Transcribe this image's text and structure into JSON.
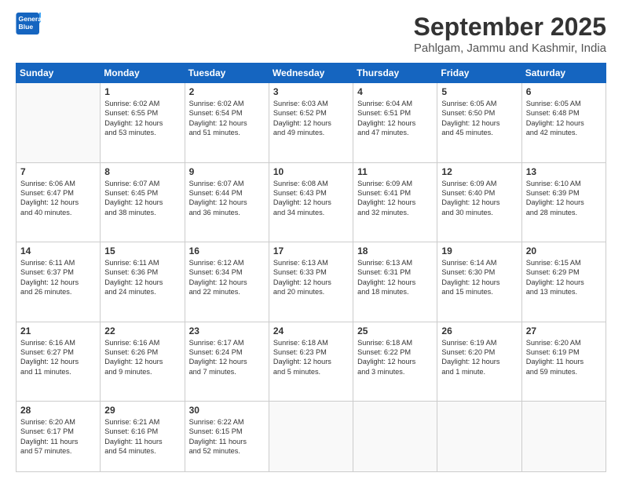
{
  "logo": {
    "line1": "General",
    "line2": "Blue"
  },
  "header": {
    "month": "September 2025",
    "location": "Pahlgam, Jammu and Kashmir, India"
  },
  "days": [
    "Sunday",
    "Monday",
    "Tuesday",
    "Wednesday",
    "Thursday",
    "Friday",
    "Saturday"
  ],
  "weeks": [
    [
      {
        "day": "",
        "info": ""
      },
      {
        "day": "1",
        "info": "Sunrise: 6:02 AM\nSunset: 6:55 PM\nDaylight: 12 hours\nand 53 minutes."
      },
      {
        "day": "2",
        "info": "Sunrise: 6:02 AM\nSunset: 6:54 PM\nDaylight: 12 hours\nand 51 minutes."
      },
      {
        "day": "3",
        "info": "Sunrise: 6:03 AM\nSunset: 6:52 PM\nDaylight: 12 hours\nand 49 minutes."
      },
      {
        "day": "4",
        "info": "Sunrise: 6:04 AM\nSunset: 6:51 PM\nDaylight: 12 hours\nand 47 minutes."
      },
      {
        "day": "5",
        "info": "Sunrise: 6:05 AM\nSunset: 6:50 PM\nDaylight: 12 hours\nand 45 minutes."
      },
      {
        "day": "6",
        "info": "Sunrise: 6:05 AM\nSunset: 6:48 PM\nDaylight: 12 hours\nand 42 minutes."
      }
    ],
    [
      {
        "day": "7",
        "info": "Sunrise: 6:06 AM\nSunset: 6:47 PM\nDaylight: 12 hours\nand 40 minutes."
      },
      {
        "day": "8",
        "info": "Sunrise: 6:07 AM\nSunset: 6:45 PM\nDaylight: 12 hours\nand 38 minutes."
      },
      {
        "day": "9",
        "info": "Sunrise: 6:07 AM\nSunset: 6:44 PM\nDaylight: 12 hours\nand 36 minutes."
      },
      {
        "day": "10",
        "info": "Sunrise: 6:08 AM\nSunset: 6:43 PM\nDaylight: 12 hours\nand 34 minutes."
      },
      {
        "day": "11",
        "info": "Sunrise: 6:09 AM\nSunset: 6:41 PM\nDaylight: 12 hours\nand 32 minutes."
      },
      {
        "day": "12",
        "info": "Sunrise: 6:09 AM\nSunset: 6:40 PM\nDaylight: 12 hours\nand 30 minutes."
      },
      {
        "day": "13",
        "info": "Sunrise: 6:10 AM\nSunset: 6:39 PM\nDaylight: 12 hours\nand 28 minutes."
      }
    ],
    [
      {
        "day": "14",
        "info": "Sunrise: 6:11 AM\nSunset: 6:37 PM\nDaylight: 12 hours\nand 26 minutes."
      },
      {
        "day": "15",
        "info": "Sunrise: 6:11 AM\nSunset: 6:36 PM\nDaylight: 12 hours\nand 24 minutes."
      },
      {
        "day": "16",
        "info": "Sunrise: 6:12 AM\nSunset: 6:34 PM\nDaylight: 12 hours\nand 22 minutes."
      },
      {
        "day": "17",
        "info": "Sunrise: 6:13 AM\nSunset: 6:33 PM\nDaylight: 12 hours\nand 20 minutes."
      },
      {
        "day": "18",
        "info": "Sunrise: 6:13 AM\nSunset: 6:31 PM\nDaylight: 12 hours\nand 18 minutes."
      },
      {
        "day": "19",
        "info": "Sunrise: 6:14 AM\nSunset: 6:30 PM\nDaylight: 12 hours\nand 15 minutes."
      },
      {
        "day": "20",
        "info": "Sunrise: 6:15 AM\nSunset: 6:29 PM\nDaylight: 12 hours\nand 13 minutes."
      }
    ],
    [
      {
        "day": "21",
        "info": "Sunrise: 6:16 AM\nSunset: 6:27 PM\nDaylight: 12 hours\nand 11 minutes."
      },
      {
        "day": "22",
        "info": "Sunrise: 6:16 AM\nSunset: 6:26 PM\nDaylight: 12 hours\nand 9 minutes."
      },
      {
        "day": "23",
        "info": "Sunrise: 6:17 AM\nSunset: 6:24 PM\nDaylight: 12 hours\nand 7 minutes."
      },
      {
        "day": "24",
        "info": "Sunrise: 6:18 AM\nSunset: 6:23 PM\nDaylight: 12 hours\nand 5 minutes."
      },
      {
        "day": "25",
        "info": "Sunrise: 6:18 AM\nSunset: 6:22 PM\nDaylight: 12 hours\nand 3 minutes."
      },
      {
        "day": "26",
        "info": "Sunrise: 6:19 AM\nSunset: 6:20 PM\nDaylight: 12 hours\nand 1 minute."
      },
      {
        "day": "27",
        "info": "Sunrise: 6:20 AM\nSunset: 6:19 PM\nDaylight: 11 hours\nand 59 minutes."
      }
    ],
    [
      {
        "day": "28",
        "info": "Sunrise: 6:20 AM\nSunset: 6:17 PM\nDaylight: 11 hours\nand 57 minutes."
      },
      {
        "day": "29",
        "info": "Sunrise: 6:21 AM\nSunset: 6:16 PM\nDaylight: 11 hours\nand 54 minutes."
      },
      {
        "day": "30",
        "info": "Sunrise: 6:22 AM\nSunset: 6:15 PM\nDaylight: 11 hours\nand 52 minutes."
      },
      {
        "day": "",
        "info": ""
      },
      {
        "day": "",
        "info": ""
      },
      {
        "day": "",
        "info": ""
      },
      {
        "day": "",
        "info": ""
      }
    ]
  ]
}
